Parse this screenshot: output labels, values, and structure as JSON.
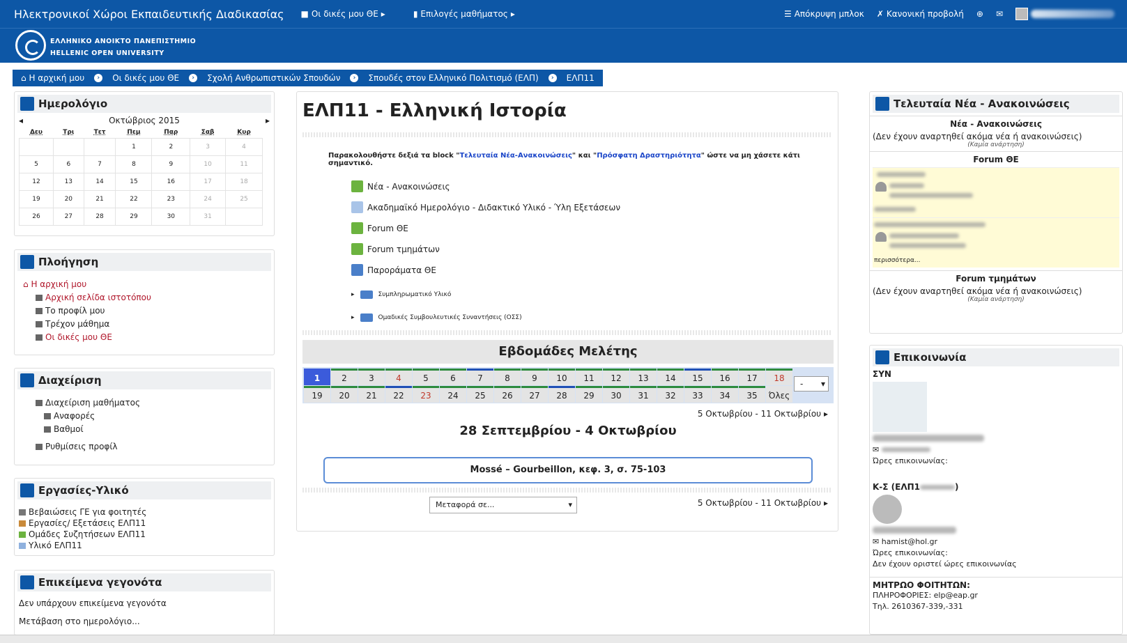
{
  "topnav": {
    "site_title": "Ηλεκτρονικοί Χώροι Εκπαιδευτικής Διαδικασίας",
    "my_courses": "Οι δικές μου ΘΕ",
    "course_options": "Επιλογές μαθήματος",
    "hide_blocks": "Απόκρυψη μπλοκ",
    "normal_view": "Κανονική προβολή"
  },
  "logo": {
    "line1": "ΕΛΛΗΝΙΚΟ ΑΝΟΙΚΤΟ ΠΑΝΕΠΙΣΤΗΜΙΟ",
    "line2": "HELLENIC OPEN UNIVERSITY"
  },
  "breadcrumb": [
    "Η αρχική μου",
    "Οι δικές μου ΘΕ",
    "Σχολή Ανθρωπιστικών Σπουδών",
    "Σπουδές στον Ελληνικό Πολιτισμό (ΕΛΠ)",
    "ΕΛΠ11"
  ],
  "calendar": {
    "title": "Ημερολόγιο",
    "month": "Οκτώβριος 2015",
    "days": [
      "Δευ",
      "Τρι",
      "Τετ",
      "Πεμ",
      "Παρ",
      "Σαβ",
      "Κυρ"
    ],
    "rows": [
      [
        "",
        "",
        "",
        "1",
        "2",
        "3",
        "4"
      ],
      [
        "5",
        "6",
        "7",
        "8",
        "9",
        "10",
        "11"
      ],
      [
        "12",
        "13",
        "14",
        "15",
        "16",
        "17",
        "18"
      ],
      [
        "19",
        "20",
        "21",
        "22",
        "23",
        "24",
        "25"
      ],
      [
        "26",
        "27",
        "28",
        "29",
        "30",
        "31",
        ""
      ]
    ]
  },
  "navigation": {
    "title": "Πλοήγηση",
    "home": "Η αρχική μου",
    "site_home": "Αρχική σελίδα ιστοτόπου",
    "profile": "Το προφίλ μου",
    "current_course": "Τρέχον μάθημα",
    "my_courses": "Οι δικές μου ΘΕ"
  },
  "admin": {
    "title": "Διαχείριση",
    "course_admin": "Διαχείριση μαθήματος",
    "reports": "Αναφορές",
    "grades": "Βαθμοί",
    "profile_settings": "Ρυθμίσεις προφίλ"
  },
  "tasks": {
    "title": "Εργασίες-Υλικό",
    "items": [
      "Βεβαιώσεις ΓΕ για φοιτητές",
      "Εργασίες/ Εξετάσεις ΕΛΠ11",
      "Ομάδες Συζητήσεων ΕΛΠ11",
      "Υλικό ΕΛΠ11"
    ]
  },
  "upcoming": {
    "title": "Επικείμενα γεγονότα",
    "none": "Δεν υπάρχουν επικείμενα γεγονότα",
    "goto": "Μετάβαση στο ημερολόγιο..."
  },
  "course": {
    "title": "ΕΛΠ11 - Ελληνική Ιστορία",
    "notice_prefix": "Παρακολουθήστε δεξιά τα block \"",
    "notice_link1": "Τελευταία Νέα-Ανακοινώσεις",
    "notice_mid": "\" και \"",
    "notice_link2": "Πρόσφατη Δραστηριότητα",
    "notice_suffix": "\" ώστε να μη χάσετε κάτι σημαντικό.",
    "resources": [
      "Νέα - Ανακοινώσεις",
      "Ακαδημαϊκό Ημερολόγιο - Διδακτικό Υλικό - Ύλη Εξετάσεων",
      "Forum ΘΕ",
      "Forum τμημάτων",
      "Παροράματα ΘΕ"
    ],
    "folders": [
      "Συμπληρωματικό Υλικό",
      "Ομαδικές Συμβουλευτικές Συναντήσεις (ΟΣΣ)"
    ],
    "weeks_title": "Εβδομάδες Μελέτης",
    "weeks_row1": [
      "1",
      "2",
      "3",
      "4",
      "5",
      "6",
      "7",
      "8",
      "9",
      "10",
      "11",
      "12",
      "13",
      "14",
      "15",
      "16",
      "17",
      "18"
    ],
    "weeks_row2": [
      "19",
      "20",
      "21",
      "22",
      "23",
      "24",
      "25",
      "26",
      "27",
      "28",
      "29",
      "30",
      "31",
      "32",
      "33",
      "34",
      "35",
      "Όλες"
    ],
    "week_select": "-",
    "next_week": "5 Οκτωβρίου - 11 Οκτωβρίου",
    "current_week": "28 Σεπτεμβρίου - 4 Οκτωβρίου",
    "summary": "Mossé – Gourbeillon, κεφ. 3, σ. 75-103",
    "move_to": "Μεταφορά σε..."
  },
  "news": {
    "title": "Τελευταία Νέα - Ανακοινώσεις",
    "sec1": "Νέα - Ανακοινώσεις",
    "none1": "(Δεν έχουν αναρτηθεί ακόμα νέα ή ανακοινώσεις)",
    "none_post": "(Καμία ανάρτηση)",
    "sec2": "Forum ΘΕ",
    "more1": "περισσότερα...",
    "more2": "περισσότερα...",
    "sec3": "Forum τμημάτων",
    "none3": "(Δεν έχουν αναρτηθεί ακόμα νέα ή ανακοινώσεις)",
    "none_post3": "(Καμία ανάρτηση)"
  },
  "contact": {
    "title": "Επικοινωνία",
    "syn": "ΣΥΝ",
    "hours_label": "Ώρες επικοινωνίας:",
    "ks": "Κ-Σ (ΕΛΠ1",
    "email2": "hamist@hol.gr",
    "hours_label2": "Ώρες επικοινωνίας:",
    "no_hours": "Δεν έχουν οριστεί ώρες επικοινωνίας",
    "registry": "ΜΗΤΡΩΟ ΦΟΙΤΗΤΩΝ:",
    "info": "ΠΛΗΡΟΦΟΡΙΕΣ: elp@eap.gr",
    "tel": "Τηλ. 2610367-339,-331"
  },
  "colors": {
    "brand": "#0d57a6",
    "accent_red": "#b0162a",
    "link_blue": "#1a45c8",
    "forum_bg": "#fffbd6"
  }
}
